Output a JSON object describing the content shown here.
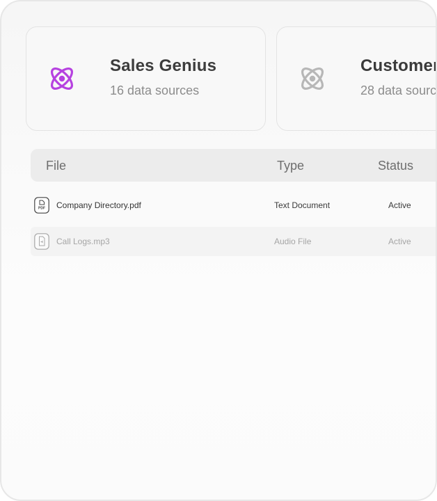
{
  "cards": [
    {
      "title": "Sales Genius",
      "subtitle": "16 data sources",
      "icon": "atom-icon",
      "icon_color": "#b642e0"
    },
    {
      "title": "Customer",
      "subtitle": "28 data sourc",
      "icon": "atom-icon",
      "icon_color": "#b7b7b7"
    }
  ],
  "table": {
    "headers": {
      "file": "File",
      "type": "Type",
      "status": "Status"
    },
    "rows": [
      {
        "name": "Company Directory.pdf",
        "type": "Text Document",
        "status": "Active",
        "icon": "pdf-file-icon"
      },
      {
        "name": "Call Logs.mp3",
        "type": "Audio File",
        "status": "Active",
        "icon": "audio-file-icon"
      }
    ]
  }
}
